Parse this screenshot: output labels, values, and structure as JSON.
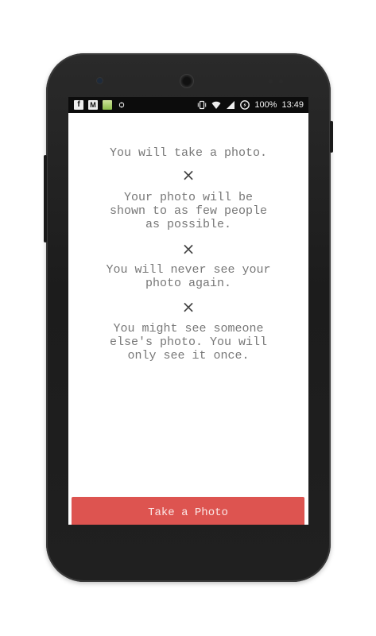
{
  "status_bar": {
    "left_icons": [
      "facebook-icon",
      "gmail-icon",
      "gallery-icon",
      "owl-icon"
    ],
    "right_icons": [
      "vibrate-icon",
      "wifi-icon",
      "signal-icon",
      "data-saver-icon"
    ],
    "battery_percent": "100%",
    "time": "13:49"
  },
  "rules": [
    "You will take a photo.",
    "Your photo will be\nshown to as few people\nas possible.",
    "You will never see your\nphoto again.",
    "You might see someone\nelse's photo. You will\nonly see it once."
  ],
  "separator_glyph": "×",
  "action": {
    "label": "Take a Photo",
    "color": "#dd5450"
  }
}
